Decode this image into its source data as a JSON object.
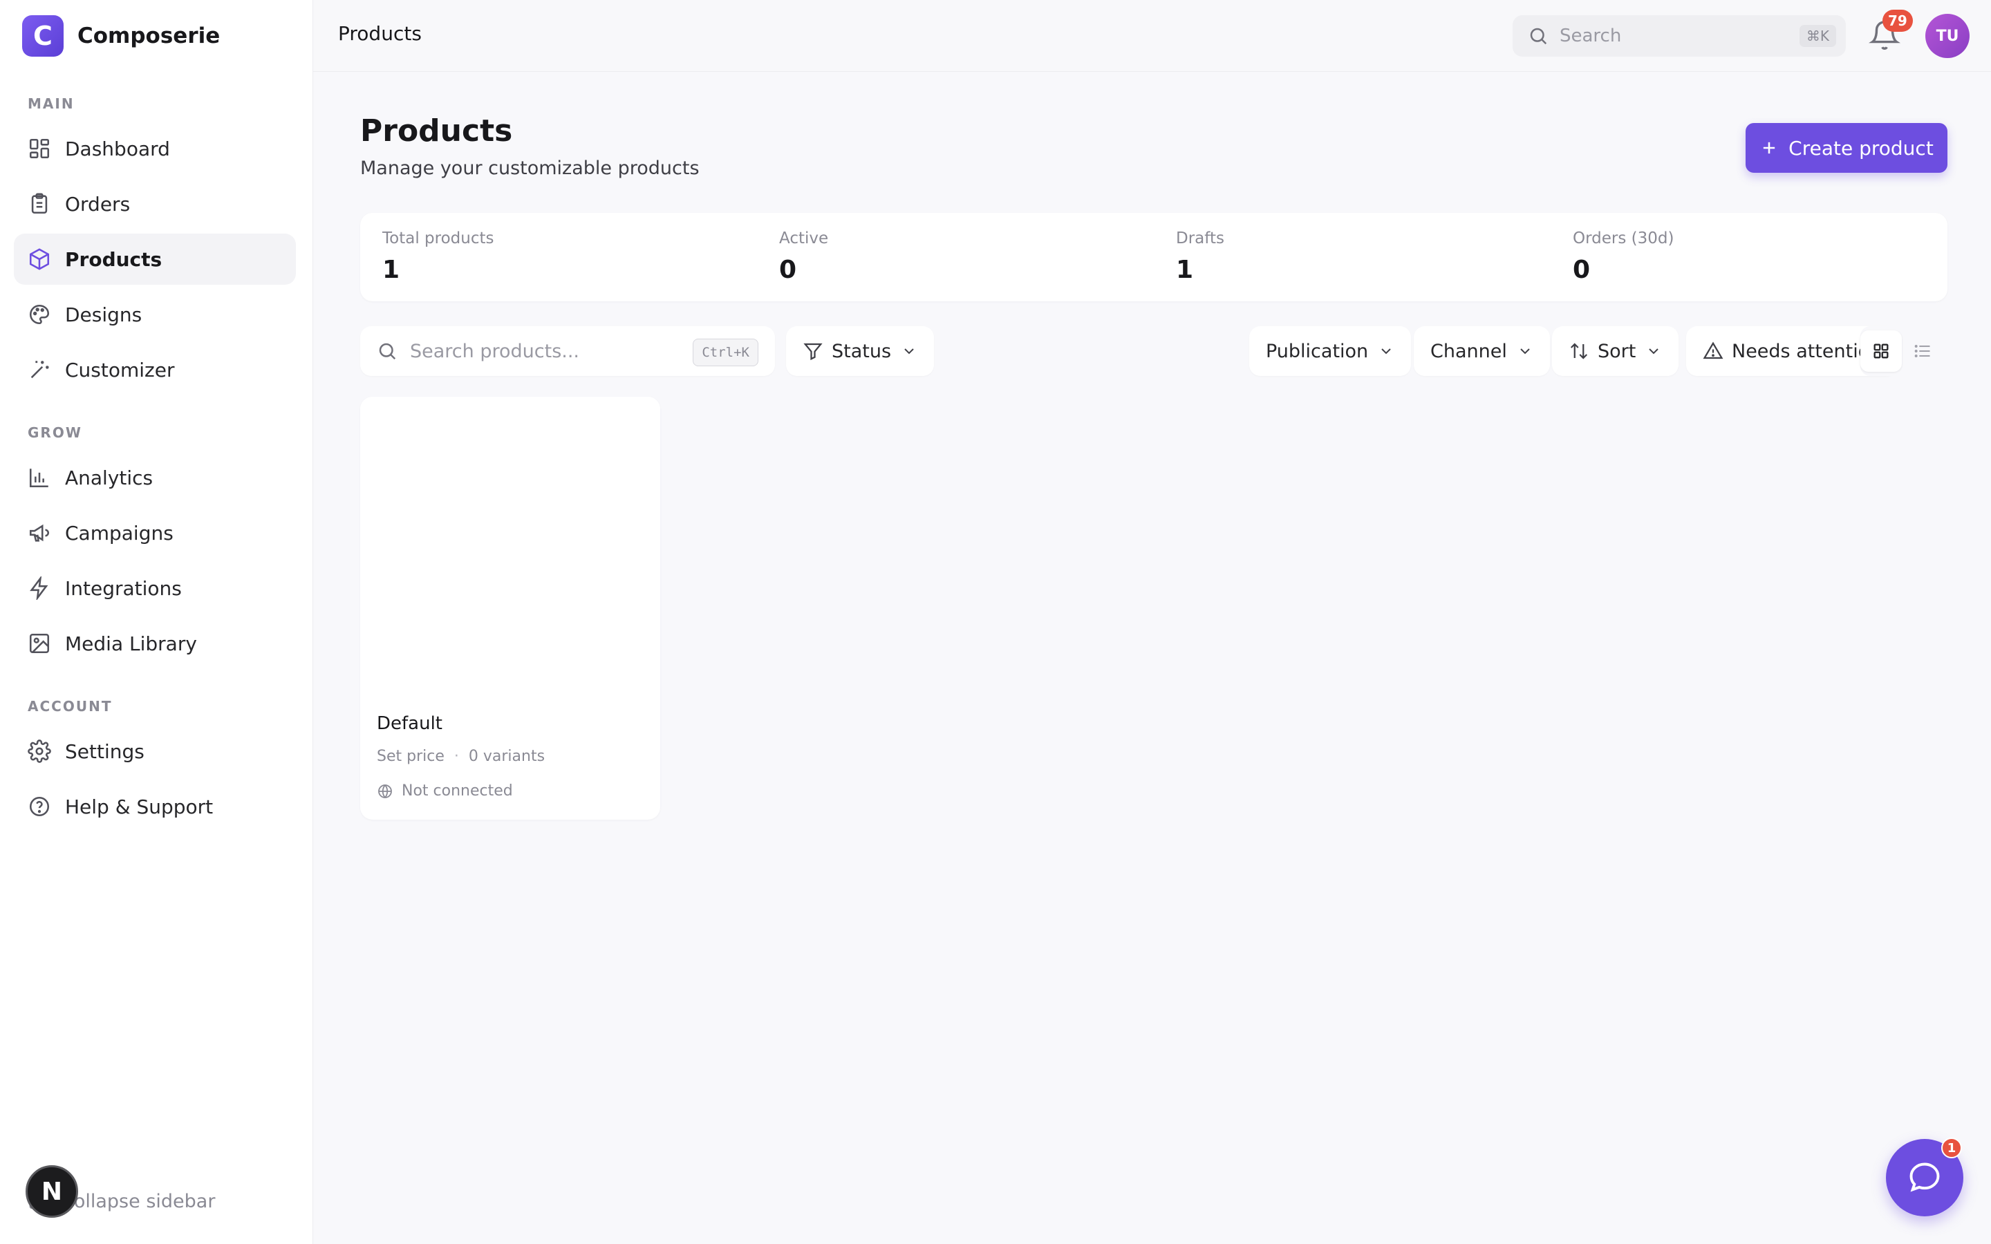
{
  "brand": {
    "logo_letter": "C",
    "name": "Composerie"
  },
  "sidebar": {
    "sections": [
      {
        "label": "MAIN"
      },
      {
        "label": "GROW"
      },
      {
        "label": "ACCOUNT"
      }
    ],
    "items": [
      {
        "label": "Dashboard",
        "icon": "dashboard-icon"
      },
      {
        "label": "Orders",
        "icon": "clipboard-icon"
      },
      {
        "label": "Products",
        "icon": "box-icon",
        "active": true
      },
      {
        "label": "Designs",
        "icon": "palette-icon"
      },
      {
        "label": "Customizer",
        "icon": "magic-wand-icon"
      },
      {
        "label": "Analytics",
        "icon": "bar-chart-icon"
      },
      {
        "label": "Campaigns",
        "icon": "megaphone-icon"
      },
      {
        "label": "Integrations",
        "icon": "lightning-icon"
      },
      {
        "label": "Media Library",
        "icon": "image-icon"
      },
      {
        "label": "Settings",
        "icon": "gear-icon"
      },
      {
        "label": "Help & Support",
        "icon": "help-circle-icon"
      }
    ],
    "collapse_label": "Collapse sidebar",
    "dev_badge": "N"
  },
  "topbar": {
    "title": "Products",
    "search_placeholder": "Search",
    "search_shortcut": "⌘K",
    "notifications_count": "79",
    "avatar_initials": "TU"
  },
  "page": {
    "title": "Products",
    "subtitle": "Manage your customizable products",
    "create_button": "Create product"
  },
  "stats": [
    {
      "label": "Total products",
      "value": "1"
    },
    {
      "label": "Active",
      "value": "0"
    },
    {
      "label": "Drafts",
      "value": "1"
    },
    {
      "label": "Orders (30d)",
      "value": "0"
    }
  ],
  "filters": {
    "search_placeholder": "Search products...",
    "search_shortcut": "Ctrl+K",
    "status": "Status",
    "publication": "Publication",
    "channel": "Channel",
    "sort": "Sort",
    "needs_attention": "Needs attention"
  },
  "products": [
    {
      "name": "Default",
      "price": "Set price",
      "variants": "0 variants",
      "connection": "Not connected"
    }
  ],
  "chat": {
    "badge": "1"
  },
  "colors": {
    "accent": "#6d4ee0",
    "badge": "#e8523f"
  }
}
